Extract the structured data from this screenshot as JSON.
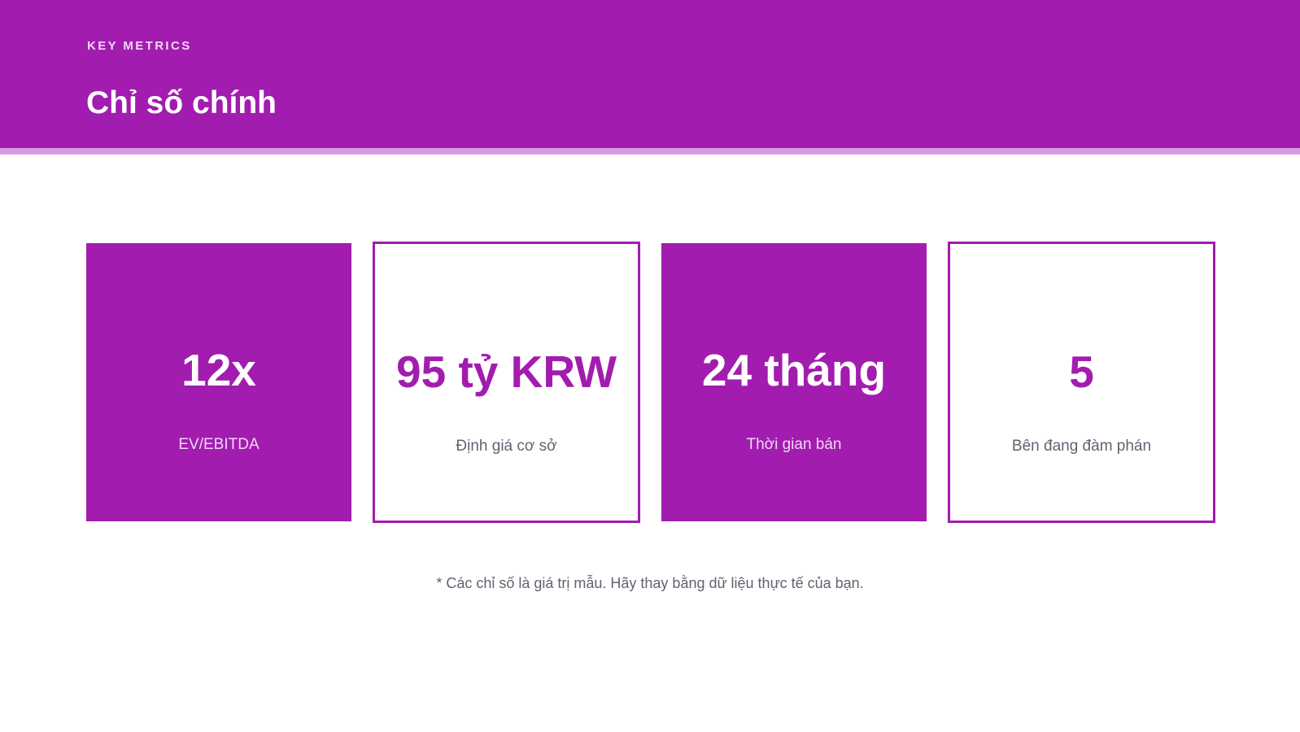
{
  "header": {
    "eyebrow": "KEY METRICS",
    "title": "Chỉ số chính"
  },
  "metrics": [
    {
      "value": "12x",
      "label": "EV/EBITDA",
      "style": "filled"
    },
    {
      "value": "95 tỷ KRW",
      "label": "Định giá cơ sở",
      "style": "outlined"
    },
    {
      "value": "24 tháng",
      "label": "Thời gian bán",
      "style": "filled"
    },
    {
      "value": "5",
      "label": "Bên đang đàm phán",
      "style": "outlined"
    }
  ],
  "footnote": "* Các chỉ số là giá trị mẫu. Hãy thay bằng dữ liệu thực tế của bạn.",
  "colors": {
    "accent": "#a21caf",
    "accent_light": "#d89be3",
    "text_muted": "#5f6470",
    "background": "#ffffff"
  }
}
